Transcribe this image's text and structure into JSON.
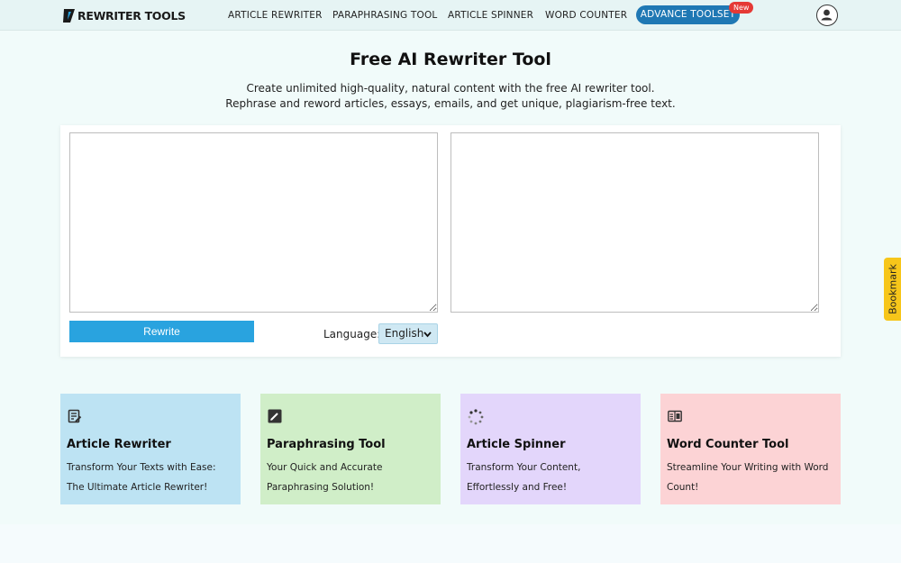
{
  "header": {
    "logo_text": "REWRITER TOOLS",
    "nav": [
      {
        "label": "ARTICLE REWRITER"
      },
      {
        "label": "PARAPHRASING TOOL"
      },
      {
        "label": "ARTICLE SPINNER"
      },
      {
        "label": "WORD COUNTER"
      }
    ],
    "advance_label": "ADVANCE TOOLSET",
    "new_badge": "New",
    "avatar_icon": "user-avatar-icon"
  },
  "hero": {
    "title": "Free AI Rewriter Tool",
    "subtitle": "Create unlimited high-quality, natural content with the free AI rewriter tool. Rephrase and reword articles, essays, emails, and get unique, plagiarism-free text."
  },
  "tool": {
    "input_value": "",
    "output_value": "",
    "rewrite_label": "Rewrite",
    "language_label": "Language:",
    "language_selected": "English"
  },
  "cards": [
    {
      "title": "Article Rewriter",
      "desc": "Transform Your Texts with Ease: The Ultimate Article Rewriter!",
      "color": "#bde3f3",
      "icon": "notes-edit-icon"
    },
    {
      "title": "Paraphrasing Tool",
      "desc": "Your Quick and Accurate Paraphrasing Solution!",
      "color": "#d0eec8",
      "icon": "pencil-square-icon"
    },
    {
      "title": "Article Spinner",
      "desc": "Transform Your Content, Effortlessly and Free!",
      "color": "#e3d6fb",
      "icon": "spinner-icon"
    },
    {
      "title": "Word Counter Tool",
      "desc": "Streamline Your Writing with Word Count!",
      "color": "#fcd3d5",
      "icon": "word-count-icon"
    }
  ],
  "colors": {
    "accent": "#1f78b4",
    "rewrite_button": "#29a3df",
    "bookmark": "#f7c61a"
  },
  "bookmark_label": "Bookmark"
}
